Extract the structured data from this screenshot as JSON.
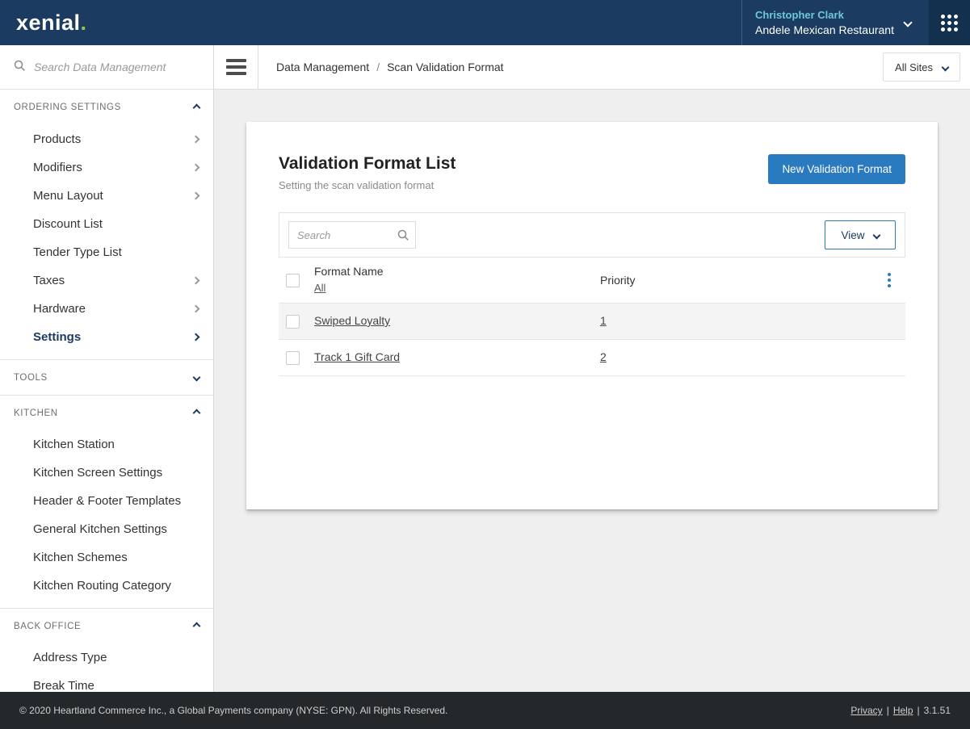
{
  "colors": {
    "header_bg": "#1b3b61",
    "accent_blue": "#2a7abf",
    "user_name_teal": "#6fc7dc",
    "logo_green": "#8dc63f",
    "footer_bg": "#24282b"
  },
  "header": {
    "logo": "xenial",
    "logo_dot": ".",
    "user_name": "Christopher Clark",
    "user_site": "Andele Mexican Restaurant"
  },
  "toolbar": {
    "breadcrumb_root": "Data Management",
    "breadcrumb_sep": "/",
    "breadcrumb_current": "Scan Validation Format",
    "sites_label": "All Sites"
  },
  "sidebar": {
    "search_placeholder": "Search Data Management",
    "sections": [
      {
        "label": "ORDERING SETTINGS",
        "items": [
          {
            "label": "Products"
          },
          {
            "label": "Modifiers"
          },
          {
            "label": "Menu Layout"
          },
          {
            "label": "Discount List"
          },
          {
            "label": "Tender Type List"
          },
          {
            "label": "Taxes"
          },
          {
            "label": "Hardware"
          },
          {
            "label": "Settings"
          }
        ]
      },
      {
        "label": "TOOLS",
        "items": []
      },
      {
        "label": "KITCHEN",
        "items": [
          {
            "label": "Kitchen Station"
          },
          {
            "label": "Kitchen Screen Settings"
          },
          {
            "label": "Header & Footer Templates"
          },
          {
            "label": "General Kitchen Settings"
          },
          {
            "label": "Kitchen Schemes"
          },
          {
            "label": "Kitchen Routing Category"
          }
        ]
      },
      {
        "label": "BACK OFFICE",
        "items": [
          {
            "label": "Address Type"
          },
          {
            "label": "Break Time"
          }
        ]
      }
    ]
  },
  "card": {
    "title": "Validation Format List",
    "subtitle": "Setting the scan validation format",
    "new_button": "New Validation Format",
    "search_placeholder": "Search",
    "view_button": "View",
    "table": {
      "columns": {
        "name": "Format Name",
        "filter_all": "All",
        "priority": "Priority"
      },
      "rows": [
        {
          "name": "Swiped Loyalty",
          "priority": "1"
        },
        {
          "name": "Track 1 Gift Card",
          "priority": "2"
        }
      ]
    }
  },
  "footer": {
    "copyright": "© 2020 Heartland Commerce Inc., a Global Payments company (NYSE: GPN). All Rights Reserved.",
    "privacy": "Privacy",
    "sep": "|",
    "help": "Help",
    "version": "3.1.51"
  }
}
